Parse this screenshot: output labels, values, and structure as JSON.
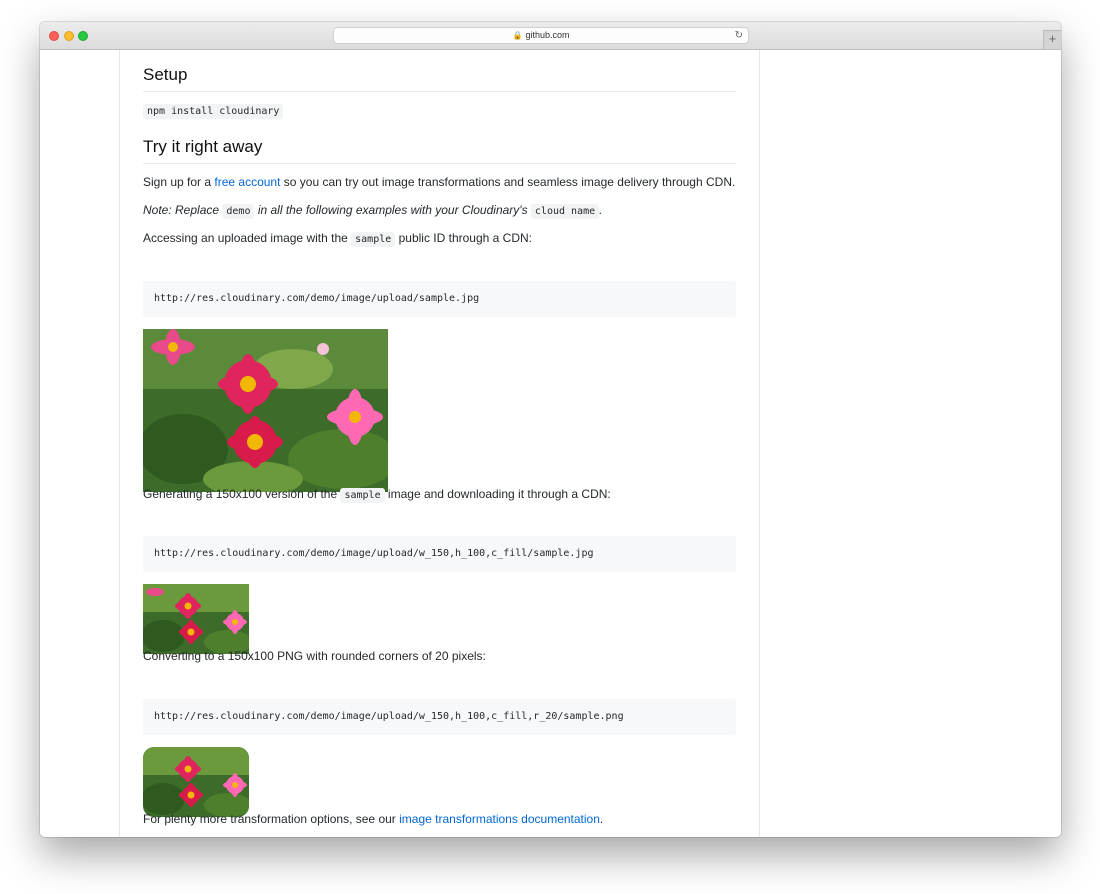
{
  "browser": {
    "url": "github.com",
    "icons": {
      "lock": "lock-icon",
      "reload": "reload-icon",
      "new_tab": "plus-icon"
    }
  },
  "readme": {
    "setup_heading": "Setup",
    "install_command": "npm install cloudinary",
    "try_heading": "Try it right away",
    "signup": {
      "before": "Sign up for a ",
      "link": "free account",
      "after": " so you can try out image transformations and seamless image delivery through CDN."
    },
    "note": {
      "before": "Note: Replace ",
      "code1": "demo",
      "middle": " in all the following examples with your Cloudinary's ",
      "code2": "cloud name",
      "after": "."
    },
    "access": {
      "before": "Accessing an uploaded image with the ",
      "code": "sample",
      "after": " public ID through a CDN:"
    },
    "code_url_1": "http://res.cloudinary.com/demo/image/upload/sample.jpg",
    "generate": {
      "before": "Generating a 150x100 version of the ",
      "code": "sample",
      "after": " image and downloading it through a CDN:"
    },
    "code_url_2": "http://res.cloudinary.com/demo/image/upload/w_150,h_100,c_fill/sample.jpg",
    "convert": "Converting to a 150x100 PNG with rounded corners of 20 pixels:",
    "code_url_3": "http://res.cloudinary.com/demo/image/upload/w_150,h_100,c_fill,r_20/sample.png",
    "more": {
      "before": "For plenty more transformation options, see our ",
      "link": "image transformations documentation",
      "after": "."
    }
  },
  "colors": {
    "link": "#0366d6",
    "code_bg": "#f6f8fa",
    "text": "#24292e"
  }
}
